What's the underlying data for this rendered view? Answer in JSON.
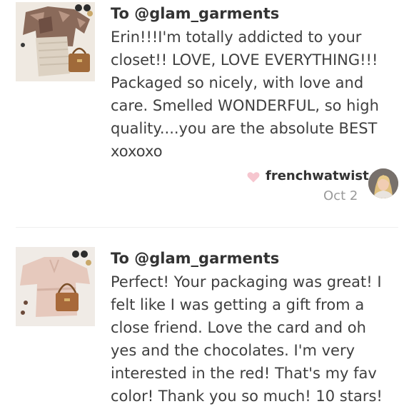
{
  "reviews": [
    {
      "to": "To @glam_garments",
      "lines": [
        "Erin!!!I'm totally addicted to your",
        "closet!! LOVE, LOVE EVERYTHING!!!",
        "Packaged so nicely, with love and",
        "care. Smelled WONDERFUL, so high",
        "quality....you are the absolute BEST",
        "xoxoxo"
      ],
      "reviewer": "frenchwatwist",
      "date": "Oct 2",
      "heart_color": "#f6c6cf"
    },
    {
      "to": "To @glam_garments",
      "lines": [
        "Perfect! Your packaging was great! I",
        "felt like I was getting a gift from a",
        "close friend. Love the card and oh",
        "yes and the chocolates. I'm very",
        "interested in the red! That's my fav",
        "color! Thank you so much! 10 stars!"
      ]
    }
  ]
}
